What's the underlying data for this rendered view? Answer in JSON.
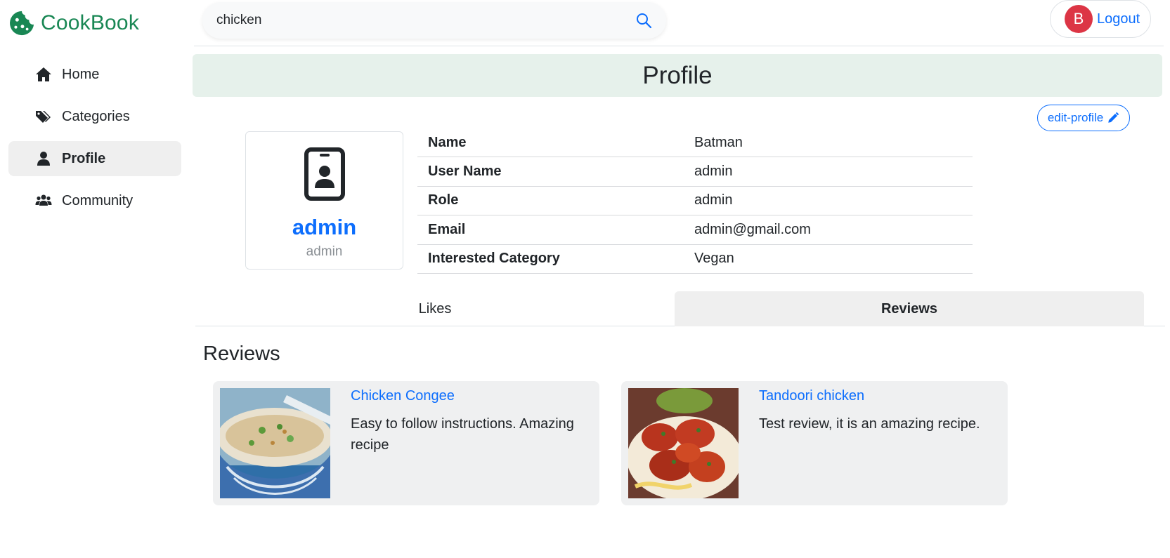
{
  "brand": {
    "name": "CookBook",
    "color": "#198754"
  },
  "sidebar": {
    "items": [
      {
        "label": "Home",
        "icon": "home-icon",
        "active": false
      },
      {
        "label": "Categories",
        "icon": "tags-icon",
        "active": false
      },
      {
        "label": "Profile",
        "icon": "user-icon",
        "active": true
      },
      {
        "label": "Community",
        "icon": "users-icon",
        "active": false
      }
    ]
  },
  "header": {
    "search": {
      "value": "chicken",
      "placeholder": ""
    },
    "avatar_initial": "B",
    "logout_label": "Logout"
  },
  "page": {
    "title": "Profile",
    "edit_label": "edit-profile"
  },
  "profile_card": {
    "name": "admin",
    "username": "admin"
  },
  "info": [
    {
      "key": "Name",
      "value": "Batman"
    },
    {
      "key": "User Name",
      "value": "admin"
    },
    {
      "key": "Role",
      "value": "admin"
    },
    {
      "key": "Email",
      "value": "admin@gmail.com"
    },
    {
      "key": "Interested Category",
      "value": "Vegan"
    }
  ],
  "tabs": [
    {
      "label": "Likes",
      "active": false
    },
    {
      "label": "Reviews",
      "active": true
    }
  ],
  "reviews": {
    "heading": "Reviews",
    "items": [
      {
        "title": "Chicken Congee",
        "text": "Easy to follow instructions. Amazing recipe"
      },
      {
        "title": "Tandoori chicken",
        "text": "Test review, it is an amazing recipe."
      }
    ]
  },
  "colors": {
    "accent": "#0d6efd",
    "danger": "#dc3545",
    "banner": "#e6f1eb"
  }
}
